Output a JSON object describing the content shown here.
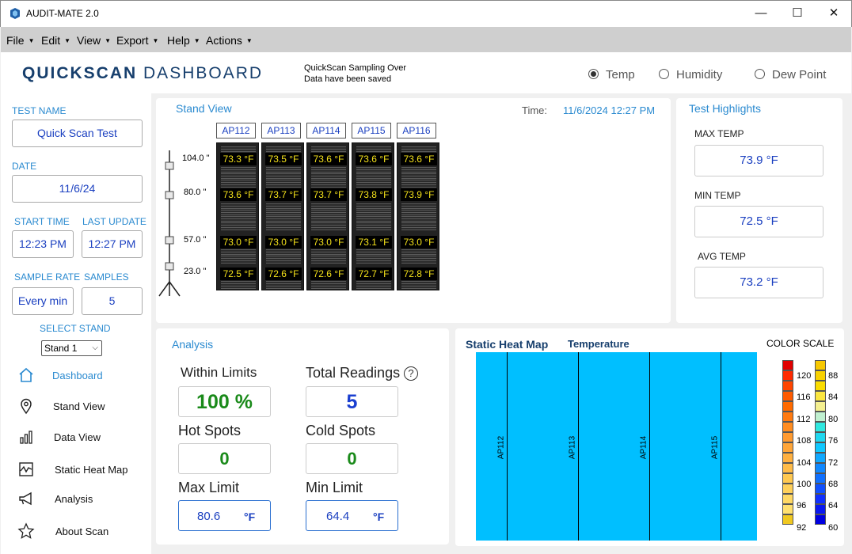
{
  "window": {
    "title": "AUDIT-MATE 2.0",
    "minimize": "—",
    "maximize": "☐",
    "close": "✕"
  },
  "menu": [
    "File",
    "Edit",
    "View",
    "Export",
    "Help",
    "Actions"
  ],
  "header": {
    "brand_bold": "QUICKSCAN",
    "brand_light": "DASHBOARD",
    "save_line1": "QuickScan Sampling Over",
    "save_line2": "Data have been saved",
    "radios": [
      {
        "label": "Temp",
        "selected": true
      },
      {
        "label": "Humidity",
        "selected": false
      },
      {
        "label": "Dew Point",
        "selected": false
      }
    ]
  },
  "sidebar": {
    "test_name_label": "TEST NAME",
    "test_name": "Quick Scan Test",
    "date_label": "DATE",
    "date": "11/6/24",
    "start_time_label": "START TIME",
    "start_time": "12:23 PM",
    "last_update_label": "LAST UPDATE",
    "last_update": "12:27 PM",
    "sample_rate_label": "SAMPLE RATE",
    "sample_rate": "Every min",
    "samples_label": "SAMPLES",
    "samples": "5",
    "select_stand_label": "SELECT STAND",
    "stand": "Stand 1",
    "nav": [
      {
        "label": "Dashboard",
        "icon": "home-icon",
        "active": true
      },
      {
        "label": "Stand View",
        "icon": "location-pin-icon"
      },
      {
        "label": "Data View",
        "icon": "bar-chart-icon"
      },
      {
        "label": "Static Heat Map",
        "icon": "heat-map-icon"
      },
      {
        "label": "Analysis",
        "icon": "megaphone-icon"
      },
      {
        "label": "About Scan",
        "icon": "star-icon"
      }
    ]
  },
  "stand_view": {
    "title": "Stand View",
    "time_label": "Time:",
    "time": "11/6/2024 12:27 PM",
    "heights": [
      "104.0 \"",
      "80.0 \"",
      "57.0 \"",
      "23.0 \""
    ],
    "racks": [
      {
        "name": "AP112",
        "readings": [
          "73.3 °F",
          "73.6 °F",
          "73.0 °F",
          "72.5 °F"
        ]
      },
      {
        "name": "AP113",
        "readings": [
          "73.5 °F",
          "73.7 °F",
          "73.0 °F",
          "72.6 °F"
        ]
      },
      {
        "name": "AP114",
        "readings": [
          "73.6 °F",
          "73.7 °F",
          "73.0 °F",
          "72.6 °F"
        ]
      },
      {
        "name": "AP115",
        "readings": [
          "73.6 °F",
          "73.8 °F",
          "73.1 °F",
          "72.7 °F"
        ]
      },
      {
        "name": "AP116",
        "readings": [
          "73.6 °F",
          "73.9 °F",
          "73.0 °F",
          "72.8 °F"
        ]
      }
    ]
  },
  "highlights": {
    "title": "Test Highlights",
    "max_label": "MAX TEMP",
    "max": "73.9 °F",
    "min_label": "MIN TEMP",
    "min": "72.5 °F",
    "avg_label": "AVG TEMP",
    "avg": "73.2 °F"
  },
  "analysis": {
    "title": "Analysis",
    "within_label": "Within Limits",
    "within": "100 %",
    "total_label": "Total Readings",
    "total": "5",
    "hot_label": "Hot Spots",
    "hot": "0",
    "cold_label": "Cold Spots",
    "cold": "0",
    "max_limit_label": "Max Limit",
    "max_limit": "80.6",
    "min_limit_label": "Min Limit",
    "min_limit": "64.4",
    "unit": "°F",
    "help": "?"
  },
  "heatmap": {
    "title": "Static Heat Map",
    "subtitle": "Temperature",
    "scale_title": "COLOR SCALE",
    "columns": [
      "AP112",
      "AP113",
      "AP114",
      "AP115"
    ],
    "fill_color": "#00bfff",
    "scale_hot": [
      "120",
      "116",
      "112",
      "108",
      "104",
      "100",
      "96",
      "92"
    ],
    "scale_cool": [
      "88",
      "84",
      "80",
      "76",
      "72",
      "68",
      "64",
      "60"
    ]
  }
}
